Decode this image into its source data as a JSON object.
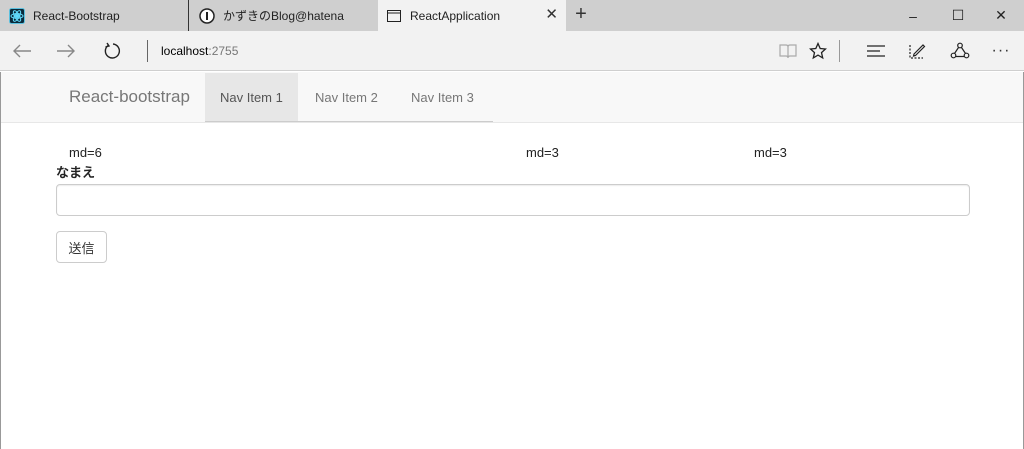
{
  "browser": {
    "tabs": [
      {
        "title": "React-Bootstrap",
        "icon": "react-bootstrap-favicon",
        "active": false
      },
      {
        "title": "かずきのBlog@hatena",
        "icon": "hatena-favicon",
        "active": false
      },
      {
        "title": "ReactApplication",
        "icon": "page-icon",
        "active": true
      }
    ],
    "new_tab": "+",
    "url_host": "localhost",
    "url_port": ":2755",
    "window_controls": {
      "minimize": "–",
      "maximize": "☐",
      "close": "✕"
    },
    "toolbar": {
      "more": "···"
    },
    "colors": {
      "tabstrip": "#cfcfcf",
      "active_tab": "#f2f2f2"
    }
  },
  "page": {
    "navbar": {
      "brand": "React-bootstrap",
      "items": [
        {
          "label": "Nav Item 1",
          "active": true
        },
        {
          "label": "Nav Item 2",
          "active": false
        },
        {
          "label": "Nav Item 3",
          "active": false
        }
      ]
    },
    "columns": [
      "md=6",
      "md=3",
      "md=3"
    ],
    "form": {
      "label": "なまえ",
      "input_value": "",
      "submit_label": "送信"
    }
  }
}
